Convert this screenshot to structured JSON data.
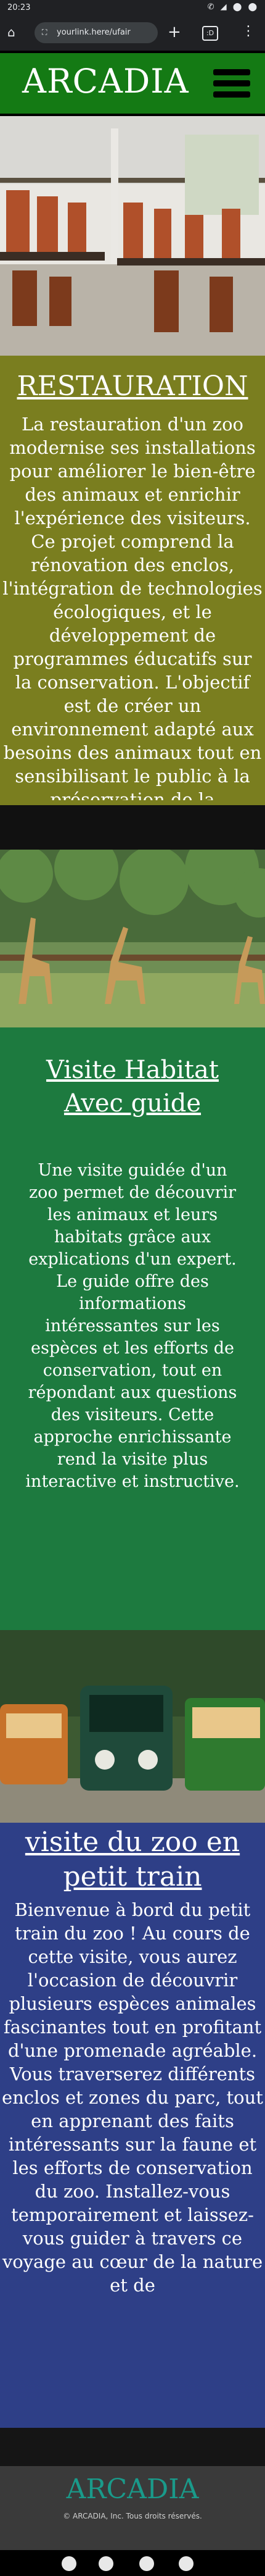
{
  "status_bar": {
    "time": "20:23",
    "icons": "✆ ◢ ⬤ ⬤"
  },
  "browser": {
    "url": "yourlink.here/ufair",
    "tab_count": ":D"
  },
  "header": {
    "logo": "ARCADIA"
  },
  "sections": {
    "restauration": {
      "title": "RESTAURATION",
      "body": "La restauration d'un zoo modernise ses installations pour améliorer le bien-être des animaux et enrichir l'expérience des visiteurs. Ce projet comprend la rénovation des enclos, l'intégration de technologies écologiques, et le développement de programmes éducatifs sur la conservation. L'objectif est de créer un environnement adapté aux besoins des animaux tout en sensibilisant le public à la préservation de la biodiversité."
    },
    "visite": {
      "title": "Visite Habitat Avec guide",
      "body": "Une visite guidée d'un zoo permet de découvrir les animaux et leurs habitats grâce aux explications d'un expert. Le guide offre des informations intéressantes sur les espèces et les efforts de conservation, tout en répondant aux questions des visiteurs. Cette approche enrichissante rend la visite plus interactive et instructive."
    },
    "train": {
      "title": "visite du zoo en petit train",
      "body": "Bienvenue à bord du petit train du zoo ! Au cours de cette visite, vous aurez l'occasion de découvrir plusieurs espèces animales fascinantes tout en profitant d'une promenade agréable. Vous traverserez différents enclos et zones du parc, tout en apprenant des faits intéressants sur la faune et les efforts de conservation du zoo. Installez-vous temporairement et laissez-vous guider à travers ce voyage au cœur de la nature et de"
    }
  },
  "footer": {
    "logo": "ARCADIA",
    "copyright": "© ARCADIA, Inc. Tous droits réservés."
  },
  "colors": {
    "header_green": "#147a14",
    "olive": "#7a7e1f",
    "green": "#1d7a3f",
    "blue": "#2e3f87",
    "footer": "#3a3a3a"
  }
}
